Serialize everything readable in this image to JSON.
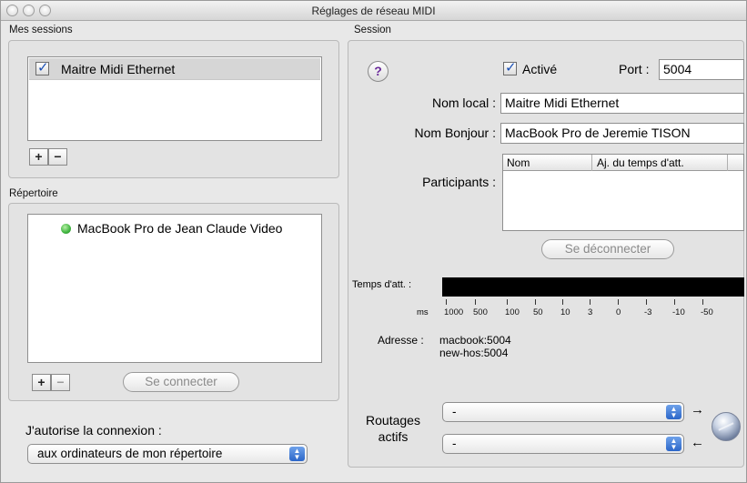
{
  "window": {
    "title": "Réglages de réseau MIDI"
  },
  "left": {
    "sessions_label": "Mes sessions",
    "sessions": [
      {
        "name": "Maitre Midi Ethernet",
        "checked": true
      }
    ],
    "add_label": "+",
    "remove_label": "−",
    "directory_label": "Répertoire",
    "directory": [
      {
        "name": "MacBook Pro de Jean Claude Video",
        "status": "online"
      }
    ],
    "connect_label": "Se connecter",
    "allow_label": "J'autorise la connexion :",
    "allow_value": "aux ordinateurs de mon répertoire"
  },
  "session": {
    "label": "Session",
    "help_label": "?",
    "enabled_label": "Activé",
    "enabled": true,
    "port_label": "Port :",
    "port_value": "5004",
    "local_name_label": "Nom local :",
    "local_name_value": "Maitre Midi Ethernet",
    "bonjour_label": "Nom Bonjour :",
    "bonjour_value": "MacBook Pro de Jeremie TISON",
    "participants_label": "Participants :",
    "participants_columns": [
      "Nom",
      "Aj. du temps d'att."
    ],
    "disconnect_label": "Se déconnecter",
    "latency_label": "Temps d'att. :",
    "latency_unit": "ms",
    "latency_ticks": [
      "1000",
      "500",
      "100",
      "50",
      "10",
      "3",
      "0",
      "-3",
      "-10",
      "-50"
    ],
    "address_label": "Adresse :",
    "address_lines": [
      "macbook:5004",
      "new-hos:5004"
    ],
    "routing_label_1": "Routages",
    "routing_label_2": "actifs",
    "routing_in": "-",
    "routing_out": "-",
    "arrow_right": "→",
    "arrow_left": "←"
  },
  "colors": {
    "accent": "#2b66c9",
    "status_online": "#3fb43f",
    "latency_bar": "#000000"
  },
  "icons": [
    "help-icon",
    "checkmark-icon",
    "status-dot-icon",
    "popup-stepper-icon",
    "network-globe-icon"
  ]
}
